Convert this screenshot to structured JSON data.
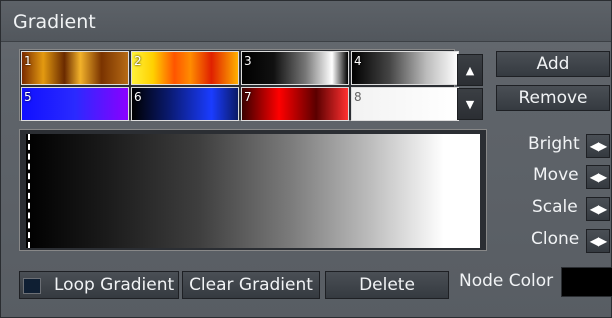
{
  "window": {
    "title": "Gradient"
  },
  "presets": [
    {
      "num": "1"
    },
    {
      "num": "2"
    },
    {
      "num": "3"
    },
    {
      "num": "4"
    },
    {
      "num": "5"
    },
    {
      "num": "6"
    },
    {
      "num": "7"
    },
    {
      "num": "8"
    }
  ],
  "buttons": {
    "add": "Add",
    "remove": "Remove",
    "loop_gradient": "Loop Gradient",
    "clear_gradient": "Clear Gradient",
    "delete": "Delete"
  },
  "controls": {
    "bright": "Bright",
    "move": "Move",
    "scale": "Scale",
    "clone": "Clone"
  },
  "node": {
    "label": "Node Color",
    "color": "#000000"
  },
  "icons": {
    "scroll_up": "▲",
    "scroll_down": "▼",
    "spin": "◀▶"
  }
}
